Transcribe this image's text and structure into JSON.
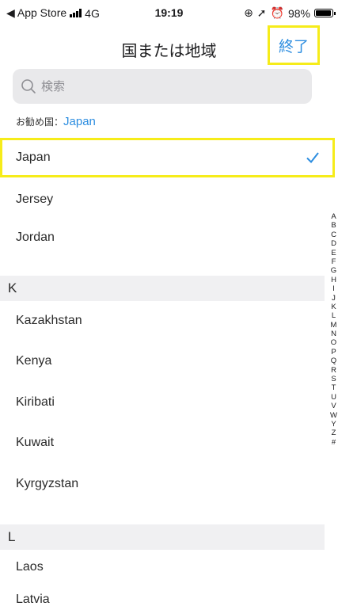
{
  "status_bar": {
    "back_label": "◀ App Store",
    "network": "4G",
    "time": "19:19",
    "battery": "98%"
  },
  "nav": {
    "title": "国または地域",
    "done_label": "終了"
  },
  "search": {
    "placeholder": "検索"
  },
  "recommended": {
    "label": "お勧め国：",
    "country": "Japan"
  },
  "list": {
    "selected": "Japan",
    "rows": [
      "Jersey",
      "Jordan"
    ],
    "section_k": {
      "header": "K",
      "items": [
        "Kazakhstan",
        "Kenya",
        "Kiribati",
        "Kuwait",
        "Kyrgyzstan"
      ]
    },
    "section_l": {
      "header": "L",
      "items": [
        "Laos",
        "Latvia"
      ]
    }
  },
  "index_letters": [
    "A",
    "B",
    "C",
    "D",
    "E",
    "F",
    "G",
    "H",
    "I",
    "J",
    "K",
    "L",
    "M",
    "N",
    "O",
    "P",
    "Q",
    "R",
    "S",
    "T",
    "U",
    "V",
    "W",
    "Y",
    "Z",
    "#"
  ],
  "colors": {
    "accent": "#2c8de0",
    "highlight": "#f6ec1a",
    "section_bg": "#f0f0f2"
  }
}
